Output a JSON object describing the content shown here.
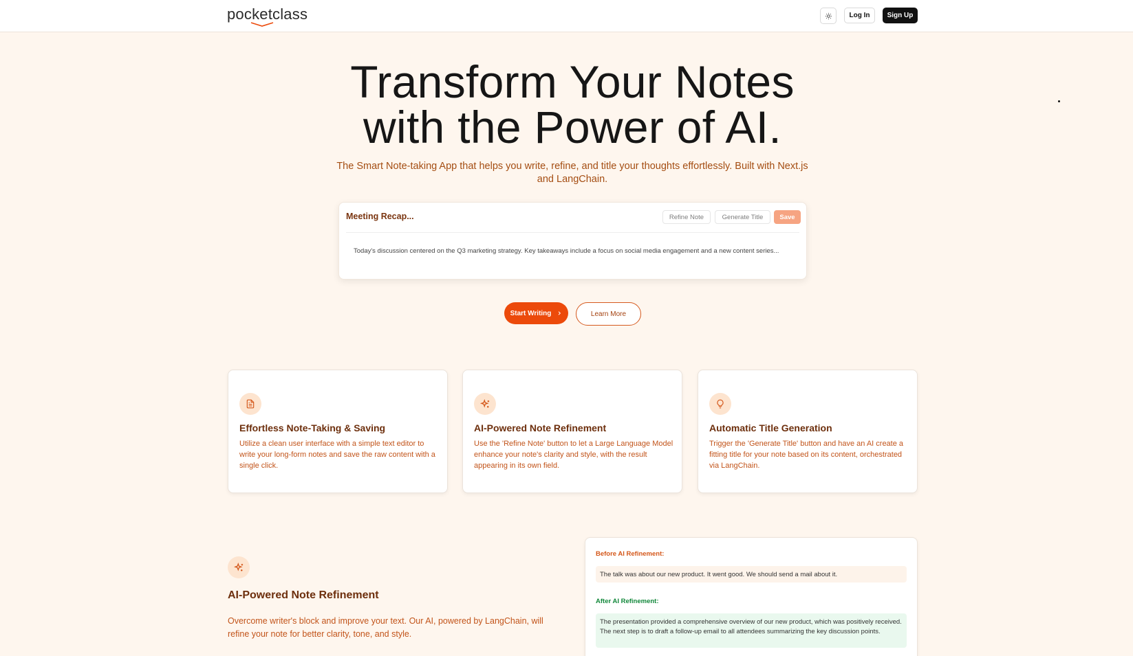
{
  "header": {
    "logo_text": "pocketclass",
    "theme_toggle_icon": "sun-icon",
    "login_label": "Log In",
    "signup_label": "Sign Up"
  },
  "hero": {
    "title_line1": "Transform Your Notes",
    "title_line2": "with the Power of AI.",
    "subtitle": "The Smart Note-taking App that helps you write, refine, and title your thoughts effortlessly. Built with Next.js and LangChain."
  },
  "note_preview": {
    "title": "Meeting Recap...",
    "refine_label": "Refine Note",
    "generate_label": "Generate Title",
    "save_label": "Save",
    "body": "Today's discussion centered on the Q3 marketing strategy. Key takeaways include a focus on social media engagement and a new content series..."
  },
  "cta": {
    "primary_label": "Start Writing",
    "primary_icon": "chevron-right-icon",
    "secondary_label": "Learn More"
  },
  "features": [
    {
      "icon": "document-icon",
      "title": "Effortless Note-Taking & Saving",
      "description": "Utilize a clean user interface with a simple text editor to write your long-form notes and save the raw content with a single click."
    },
    {
      "icon": "sparkles-icon",
      "title": "AI-Powered Note Refinement",
      "description": "Use the 'Refine Note' button to let a Large Language Model enhance your note's clarity and style, with the result appearing in its own field."
    },
    {
      "icon": "lightbulb-icon",
      "title": "Automatic Title Generation",
      "description": "Trigger the 'Generate Title' button and have an AI create a fitting title for your note based on its content, orchestrated via LangChain."
    }
  ],
  "refinement_section": {
    "icon": "sparkles-icon",
    "title": "AI-Powered Note Refinement",
    "description": "Overcome writer's block and improve your text. Our AI, powered by LangChain, will refine your note for better clarity, tone, and style.",
    "before_label": "Before AI Refinement:",
    "before_text": "The talk was about our new product. It went good. We should send a mail about it.",
    "after_label": "After AI Refinement:",
    "after_text": "The presentation provided a comprehensive overview of our new product, which was positively received. The next step is to draft a follow-up email to all attendees summarizing the key discussion points."
  },
  "colors": {
    "accent": "#ec4a0b",
    "page_bg": "#fef6ee",
    "heading_brown": "#6d2f0d",
    "text_orange": "#c2541a",
    "after_green": "#12883b"
  }
}
